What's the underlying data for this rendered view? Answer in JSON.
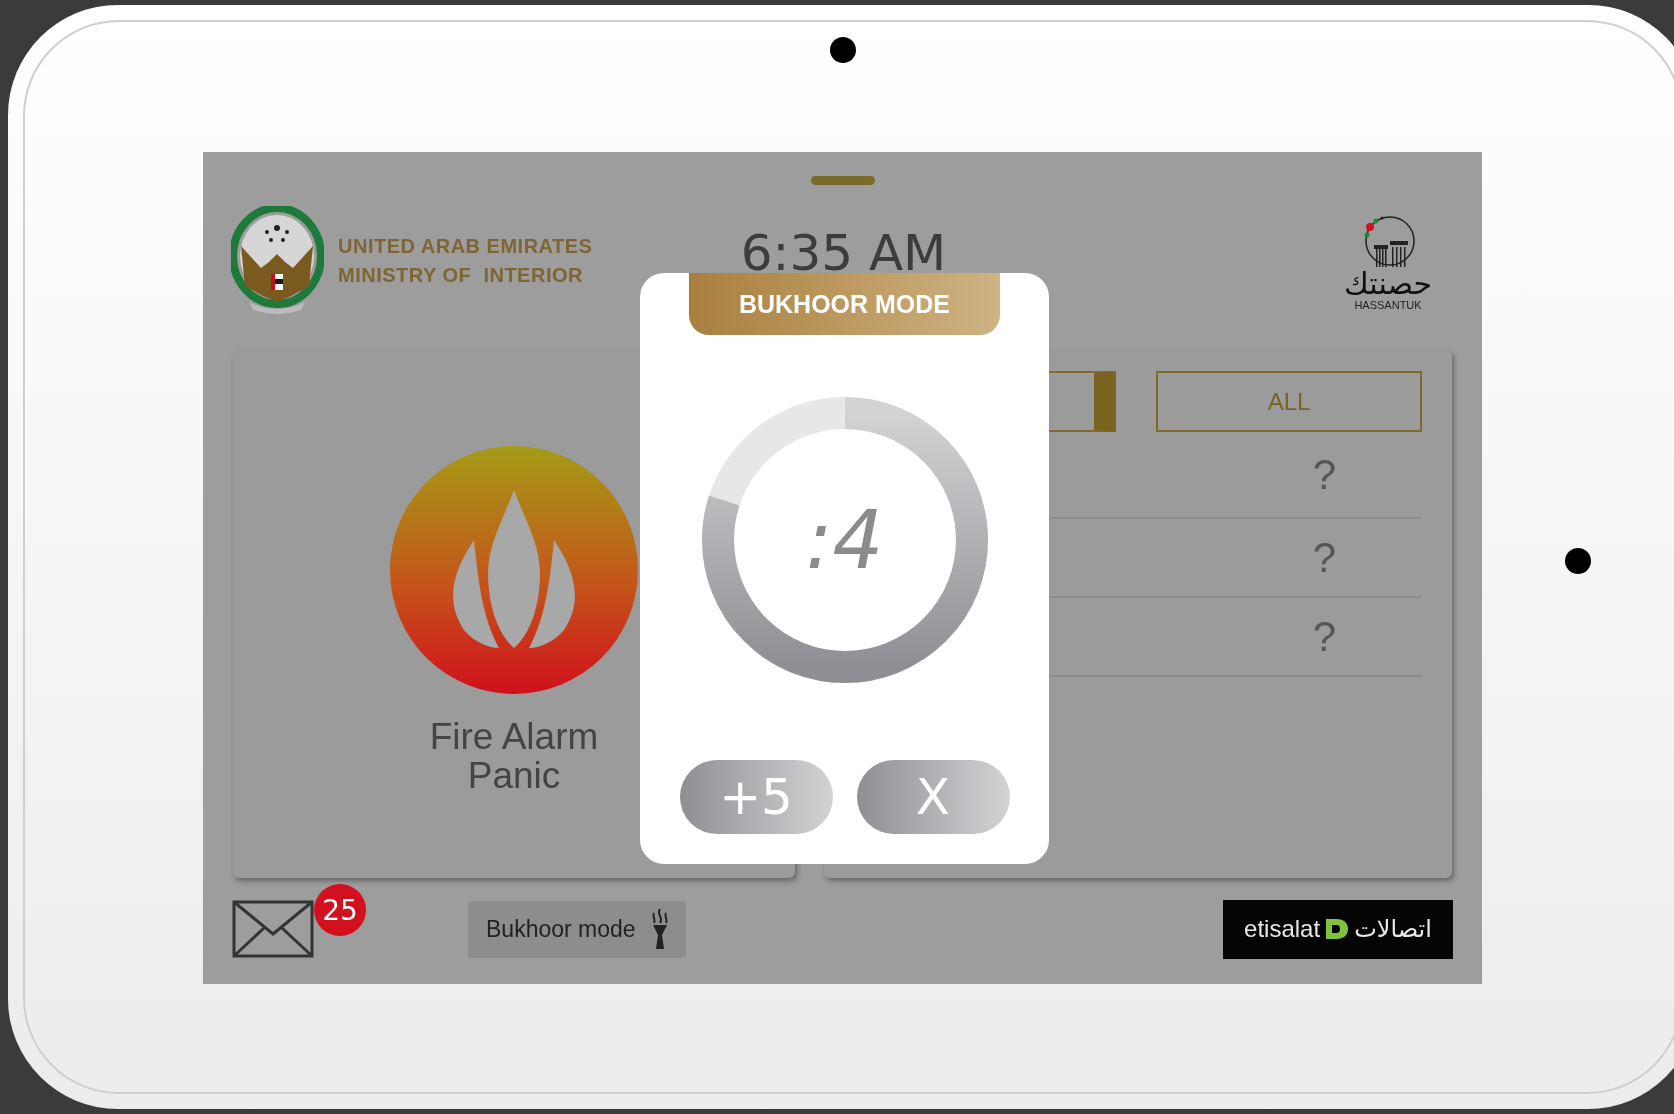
{
  "header": {
    "org_lines": [
      "UNITED ARAB EMIRATES",
      "MINISTRY OF  INTERIOR"
    ],
    "time": "6:35 AM",
    "brand": {
      "arabic": "حصنتك",
      "latin": "HASSANTUK"
    }
  },
  "alarm_card": {
    "label": "Fire Alarm Panic"
  },
  "filter_tabs": [
    {
      "selected": true
    },
    {
      "label": "ALL",
      "selected": false
    }
  ],
  "zone_rows": [
    {
      "status": "?"
    },
    {
      "status": "?"
    },
    {
      "status": "?"
    }
  ],
  "footer": {
    "message_count": "25",
    "mode_button": "Bukhoor mode",
    "carrier": {
      "latin": "etisalat",
      "arabic": "اتصالات"
    }
  },
  "dialog": {
    "title": "BUKHOOR MODE",
    "remaining": ":4",
    "level": 0.8,
    "buttons": [
      {
        "label": "+5"
      },
      {
        "label": "X"
      }
    ]
  }
}
